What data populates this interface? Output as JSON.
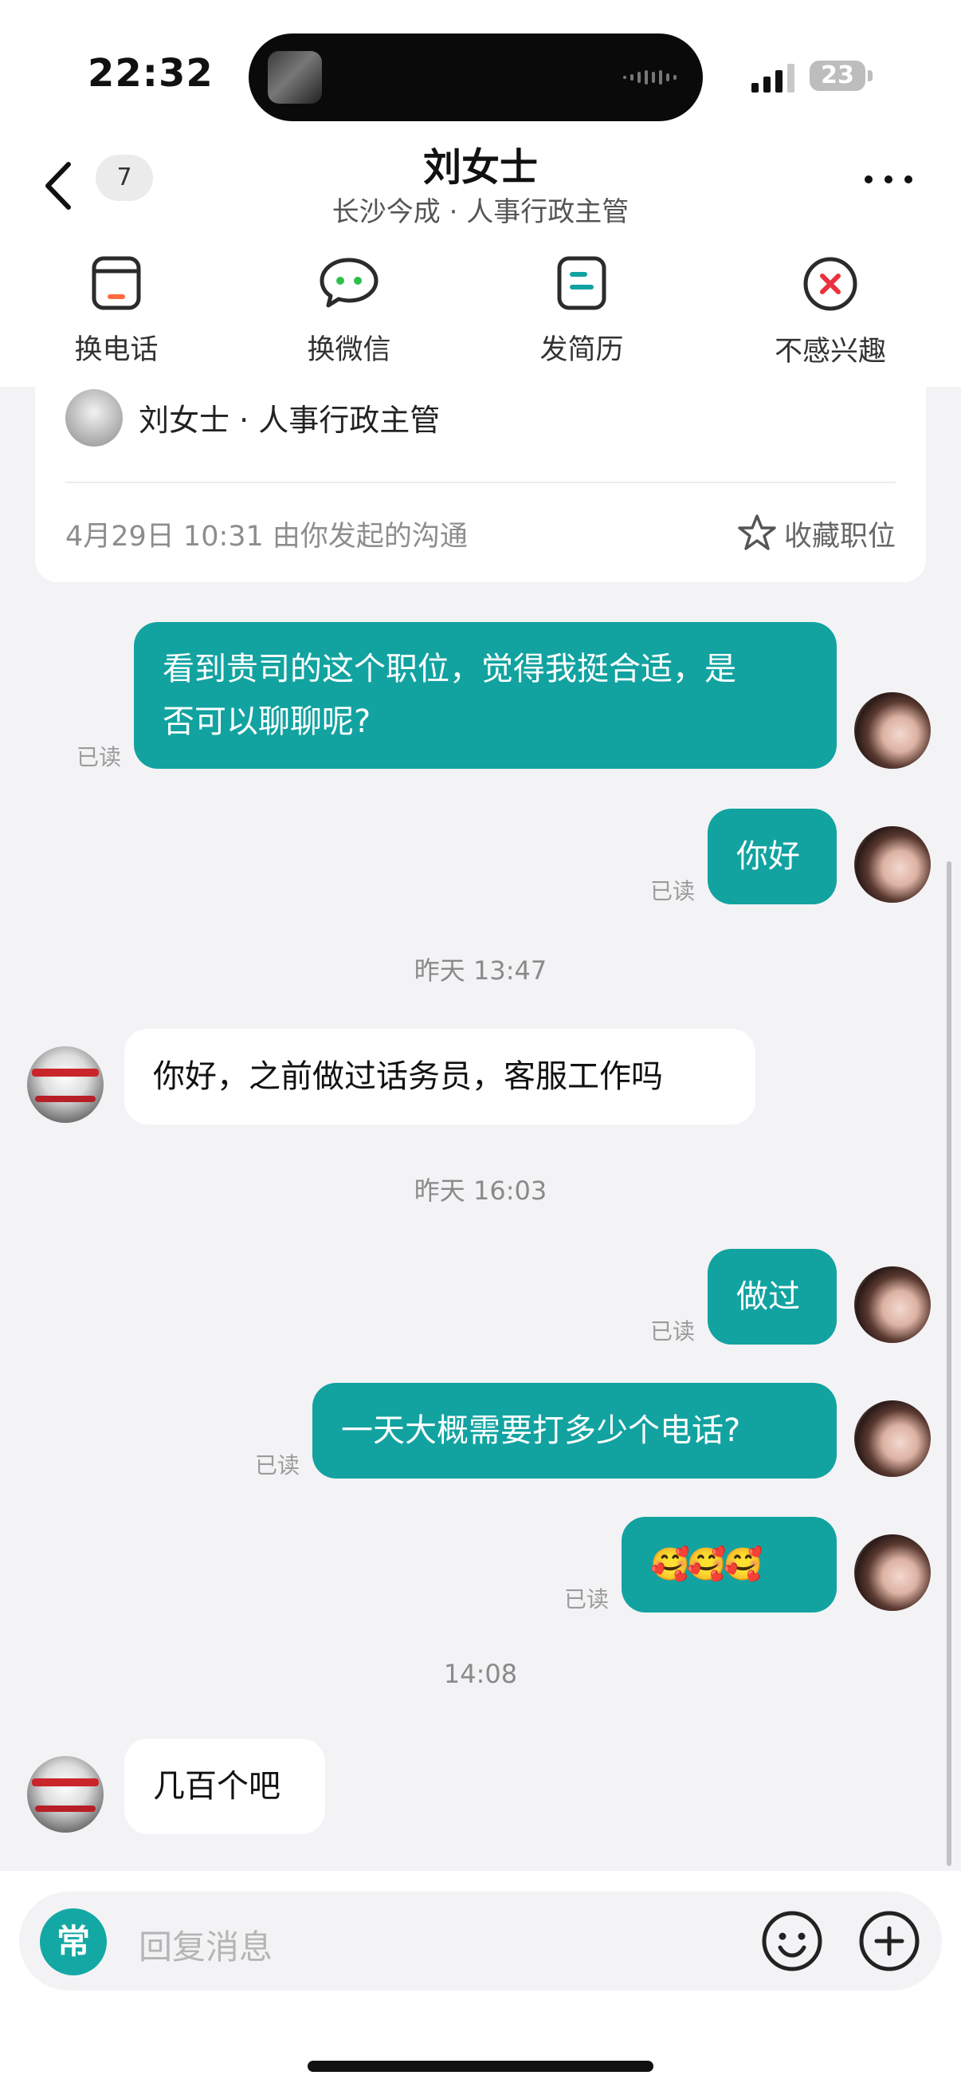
{
  "status_bar": {
    "time": "22:32",
    "battery": "23"
  },
  "header": {
    "unread_count": "7",
    "contact_name": "刘女士",
    "contact_subtitle": "长沙今成 · 人事行政主管"
  },
  "actions": [
    {
      "label": "换电话",
      "icon": "phone-card-icon"
    },
    {
      "label": "换微信",
      "icon": "wechat-bubble-icon"
    },
    {
      "label": "发简历",
      "icon": "resume-doc-icon"
    },
    {
      "label": "不感兴趣",
      "icon": "close-circle-icon"
    }
  ],
  "job_card": {
    "recruiter_line": "刘女士 · 人事行政主管",
    "meta": "4月29日 10:31 由你发起的沟通",
    "favorite_label": "收藏职位"
  },
  "messages": [
    {
      "from": "me",
      "text_line1": "看到贵司的这个职位，觉得我挺合适，是",
      "text_line2": "否可以聊聊呢?",
      "status": "已读"
    },
    {
      "from": "me",
      "text": "你好",
      "status": "已读"
    },
    {
      "timestamp": "昨天 13:47"
    },
    {
      "from": "them",
      "text": "你好，之前做过话务员，客服工作吗"
    },
    {
      "timestamp": "昨天 16:03"
    },
    {
      "from": "me",
      "text": "做过",
      "status": "已读"
    },
    {
      "from": "me",
      "text": "一天大概需要打多少个电话?",
      "status": "已读"
    },
    {
      "from": "me",
      "text": "🥰🥰🥰",
      "status": "已读"
    },
    {
      "timestamp": "14:08"
    },
    {
      "from": "them",
      "text": "几百个吧"
    }
  ],
  "input": {
    "quick_label": "常",
    "placeholder": "回复消息"
  },
  "colors": {
    "accent": "#12a3a1",
    "background": "#f3f3f5",
    "danger": "#e8323e"
  }
}
